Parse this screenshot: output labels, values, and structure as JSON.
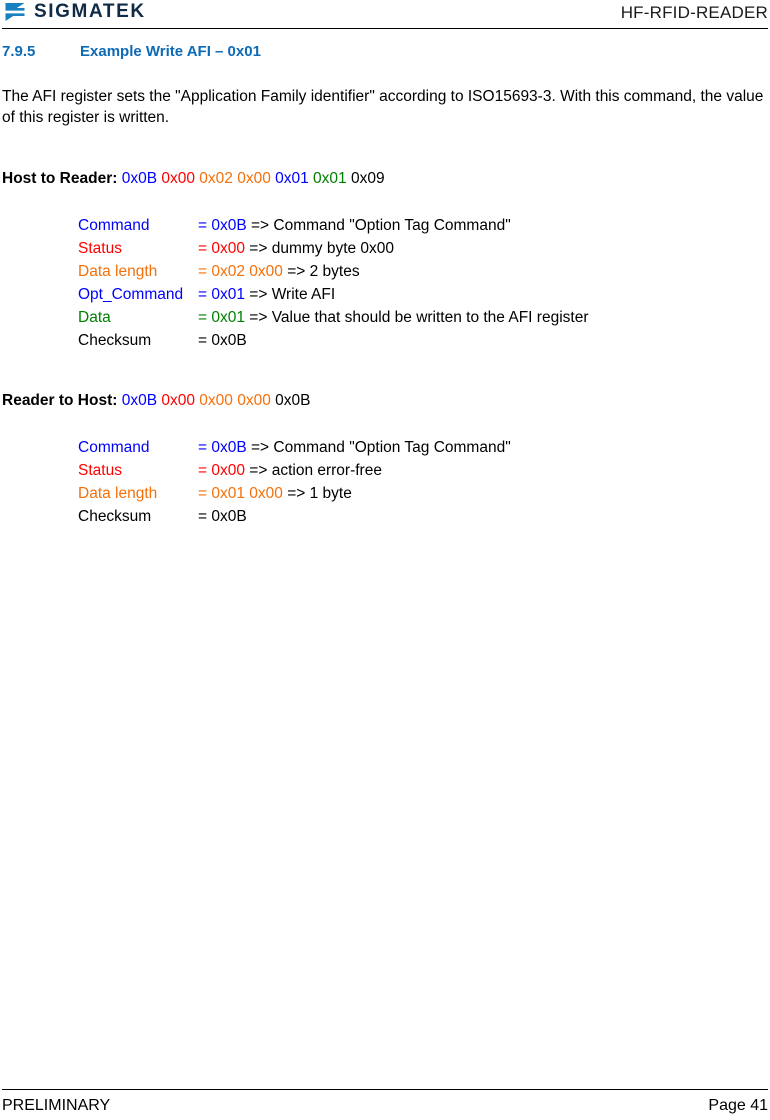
{
  "header": {
    "logo_icon": "sigmatek-sigma-logo-icon",
    "logo_text": "SIGMATEK",
    "document_title": "HF-RFID-READER"
  },
  "section": {
    "number": "7.9.5",
    "title": "Example Write AFI – 0x01"
  },
  "intro": {
    "paragraph": "The AFI register sets the \"Application Family identifier\" according to ISO15693-3. With this command, the value of this register is written."
  },
  "host_to_reader": {
    "label": "Host to Reader:",
    "bytes": [
      {
        "text": "0x0B",
        "color": "#0000ff"
      },
      {
        "text": "0x00",
        "color": "#ff0000"
      },
      {
        "text": "0x02",
        "color": "#f4700a"
      },
      {
        "text": "0x00",
        "color": "#f4700a"
      },
      {
        "text": "0x01",
        "color": "#0000ff"
      },
      {
        "text": "0x01",
        "color": "#008000"
      },
      {
        "text": "0x09",
        "color": "#000000"
      }
    ],
    "rows": [
      {
        "label": "Command",
        "label_color": "#0000ff",
        "eq": "= 0x0B",
        "eq_color": "#0000ff",
        "desc": "=> Command \"Option Tag Command\""
      },
      {
        "label": "Status",
        "label_color": "#ff0000",
        "eq": "= 0x00",
        "eq_color": "#ff0000",
        "desc": "=> dummy byte 0x00"
      },
      {
        "label": "Data length",
        "label_color": "#f4700a",
        "eq": "= 0x02 0x00",
        "eq_color": "#f4700a",
        "desc": "=> 2 bytes"
      },
      {
        "label": "Opt_Command",
        "label_color": "#0000ff",
        "eq": "= 0x01",
        "eq_color": "#0000ff",
        "desc": "=> Write AFI"
      },
      {
        "label": "Data",
        "label_color": "#008000",
        "eq": "= 0x01",
        "eq_color": "#008000",
        "desc": "=> Value that should be written to the AFI register"
      },
      {
        "label": "Checksum",
        "label_color": "#000000",
        "eq": "= 0x0B",
        "eq_color": "#000000",
        "desc": ""
      }
    ]
  },
  "reader_to_host": {
    "label": "Reader to Host:",
    "bytes": [
      {
        "text": "0x0B",
        "color": "#0000ff"
      },
      {
        "text": "0x00",
        "color": "#ff0000"
      },
      {
        "text": "0x00",
        "color": "#f4700a"
      },
      {
        "text": "0x00",
        "color": "#f4700a"
      },
      {
        "text": "0x0B",
        "color": "#000000"
      }
    ],
    "rows": [
      {
        "label": "Command",
        "label_color": "#0000ff",
        "eq": "= 0x0B",
        "eq_color": "#0000ff",
        "desc": "=> Command \"Option Tag Command\""
      },
      {
        "label": "Status",
        "label_color": "#ff0000",
        "eq": "= 0x00",
        "eq_color": "#ff0000",
        "desc": "=> action error-free"
      },
      {
        "label": "Data length",
        "label_color": "#f4700a",
        "eq": "= 0x01 0x00",
        "eq_color": "#f4700a",
        "desc": "=> 1 byte"
      },
      {
        "label": "Checksum",
        "label_color": "#000000",
        "eq": "= 0x0B",
        "eq_color": "#000000",
        "desc": ""
      }
    ]
  },
  "footer": {
    "left": "PRELIMINARY",
    "right": "Page 41"
  },
  "colors": {
    "heading_blue": "#0d6ab5",
    "logo_blue": "#1a7fc1",
    "logo_navy": "#0f2b46",
    "blue": "#0000ff",
    "red": "#ff0000",
    "orange": "#f4700a",
    "green": "#008000",
    "black": "#000000"
  }
}
